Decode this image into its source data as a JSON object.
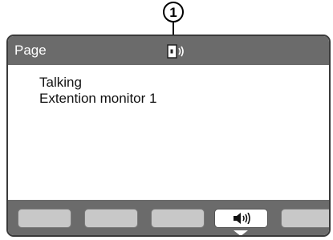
{
  "callout": {
    "label": "1"
  },
  "title_bar": {
    "title": "Page",
    "status_icon": "speaker-phone-icon"
  },
  "content": {
    "lines": [
      "Talking",
      "Extention monitor 1"
    ]
  },
  "softkeys": [
    {
      "label": "",
      "icon": null
    },
    {
      "label": "",
      "icon": null
    },
    {
      "label": "",
      "icon": null
    },
    {
      "label": "",
      "icon": "speaker-icon",
      "active": true
    },
    {
      "label": "",
      "icon": null
    }
  ],
  "colors": {
    "bar": "#6b6b6b",
    "softkey": "#c8c8c8",
    "softkey_active": "#ffffff"
  }
}
